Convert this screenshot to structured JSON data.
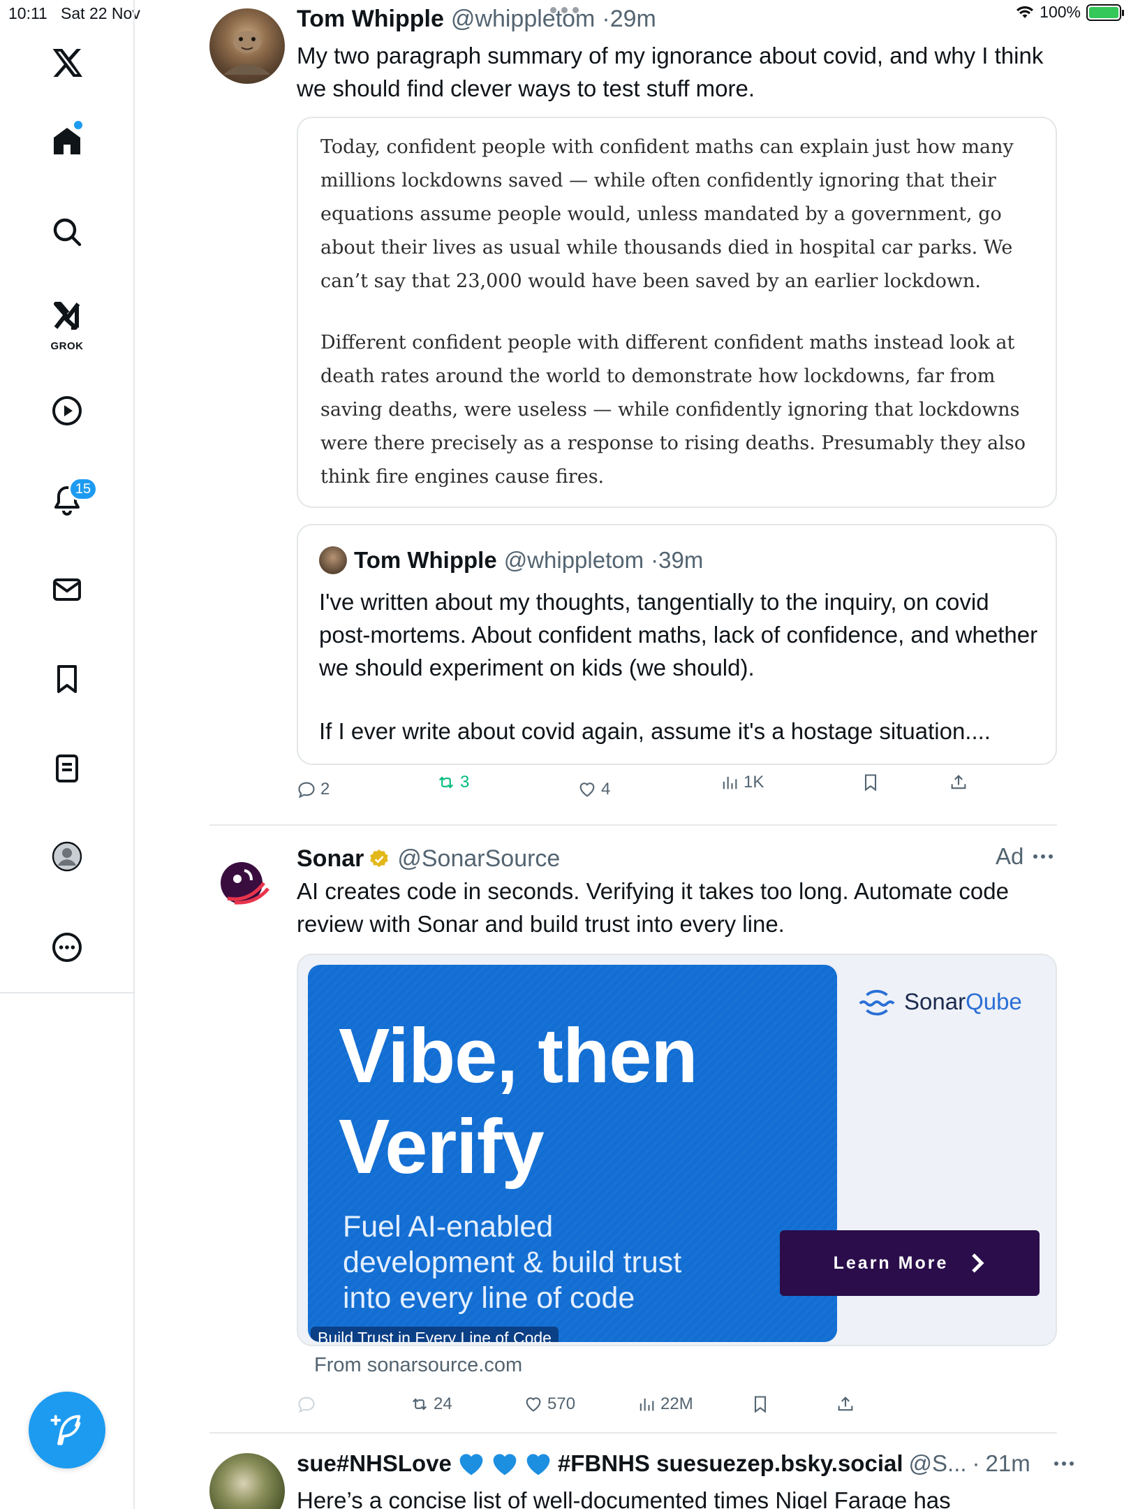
{
  "status_bar": {
    "time": "10:11",
    "date": "Sat 22 Nov",
    "battery": "100%"
  },
  "sidebar": {
    "grok_label": "GROK",
    "notifications_badge": "15",
    "icons": [
      "x-logo-icon",
      "home-icon",
      "search-icon",
      "grok-icon",
      "video-icon",
      "bell-icon",
      "mail-icon",
      "bookmark-icon",
      "lists-icon",
      "profile-icon",
      "more-icon",
      "compose-icon"
    ]
  },
  "tweet1": {
    "name": "Tom Whipple",
    "handle": "@whippletom",
    "time": "29m",
    "text": "My two paragraph summary of my ignorance about covid, and why I think we should find clever ways to test stuff more.",
    "image_paragraph_1": "Today, confident people with confident maths can explain just how many millions lockdowns saved — while often confidently ignoring that their equations assume people would, unless mandated by a government, go about their lives as usual while thousands died in hospital car parks. We can’t say that 23,000 would have been saved by an earlier lockdown.",
    "image_paragraph_2": "Different confident people with different confident maths instead look at death rates around the world to demonstrate how lockdowns, far from saving deaths, were useless — while confidently ignoring that lockdowns were there precisely as a response to rising deaths. Presumably they also think fire engines cause fires.",
    "quoted": {
      "name": "Tom Whipple",
      "handle": "@whippletom",
      "time": "39m",
      "paragraph_1": "I've written about my thoughts, tangentially to the inquiry, on covid post-mortems. About confident maths, lack of confidence, and whether we should experiment on kids (we should).",
      "paragraph_2": "If I ever write about covid again, assume it's a hostage situation...."
    },
    "actions": {
      "replies": "2",
      "reposts": "3",
      "likes": "4",
      "views": "1K"
    }
  },
  "tweet2": {
    "name": "Sonar",
    "handle": "@SonarSource",
    "ad_label": "Ad",
    "text": "AI creates code in seconds. Verifying it takes too long. Automate code review with Sonar and build trust into every line.",
    "card": {
      "headline_line1": "Vibe, then",
      "headline_line2": "Verify",
      "sub_line1": "Fuel AI-enabled",
      "sub_line2": "development & build trust",
      "sub_line3": "into every line of code",
      "caption": "Build Trust in Every Line of Code",
      "brand_part1": "Sonar",
      "brand_part2": "Qube",
      "cta": "Learn More"
    },
    "from": "From sonarsource.com",
    "actions": {
      "reposts": "24",
      "likes": "570",
      "views": "22M"
    }
  },
  "tweet3": {
    "name_part1": "sue#NHSLove",
    "name_part2": "#FBNHS suesuezep.bsky.social",
    "handle": "@S...",
    "time": "21m",
    "text": "Here’s a concise list of well-documented times Nigel Farage has"
  },
  "colors": {
    "accent": "#1d9bf0",
    "repost_green": "#00ba7c",
    "ad_blue": "#126ed3",
    "cta_purple": "#2a0d4a"
  }
}
